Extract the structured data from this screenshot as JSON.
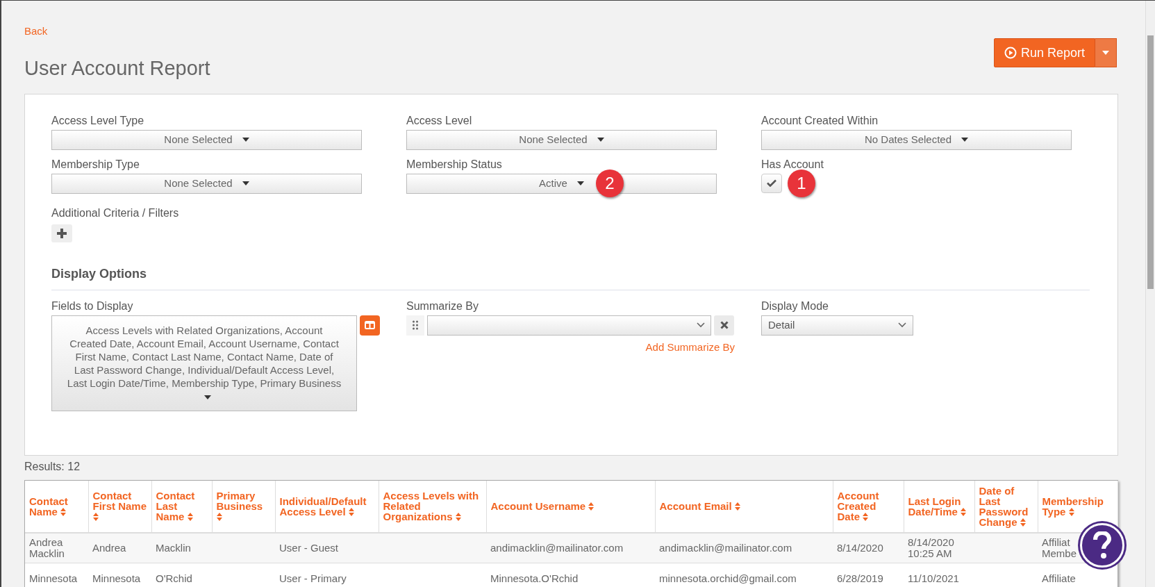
{
  "back_link": "Back",
  "title": "User Account Report",
  "run_button": {
    "label": "Run Report"
  },
  "filters": [
    {
      "label": "Access Level Type",
      "kind": "dropdown",
      "value": "None Selected"
    },
    {
      "label": "Access Level",
      "kind": "dropdown",
      "value": "None Selected"
    },
    {
      "label": "Account Created Within",
      "kind": "dropdown",
      "value": "No Dates Selected"
    },
    {
      "label": "Membership Type",
      "kind": "dropdown",
      "value": "None Selected"
    },
    {
      "label": "Membership Status",
      "kind": "dropdown",
      "value": "Active",
      "callout": "2"
    },
    {
      "label": "Has Account",
      "kind": "checkbox",
      "checked": true,
      "callout": "1"
    }
  ],
  "additional_criteria": {
    "label": "Additional Criteria / Filters"
  },
  "display_options": {
    "heading": "Display Options",
    "fields_to_display": {
      "label": "Fields to Display",
      "value": "Access Levels with Related Organizations,  Account Created Date,  Account Email,  Account Username,  Contact First Name,  Contact Last Name,  Contact Name,  Date of Last Password Change,  Individual/Default Access Level,  Last Login Date/Time,  Membership Type,  Primary Business"
    },
    "summarize_by": {
      "label": "Summarize By",
      "link": "Add Summarize By"
    },
    "display_mode": {
      "label": "Display Mode",
      "value": "Detail"
    }
  },
  "results": "Results: 12",
  "table": {
    "columns": [
      "Contact Name",
      "Contact First Name",
      "Contact Last Name",
      "Primary Business",
      "Individual/Default Access Level",
      "Access Levels with Related Organizations",
      "Account Username",
      "Account Email",
      "Account Created Date",
      "Last Login Date/Time",
      "Date of Last Password Change",
      "Membership Type"
    ],
    "rows": [
      [
        "Andrea Macklin",
        "Andrea",
        "Macklin",
        "",
        "User - Guest",
        "",
        "andimacklin@mailinator.com",
        "andimacklin@mailinator.com",
        "8/14/2020",
        "8/14/2020 10:25 AM",
        "",
        "Affiliat Membe"
      ],
      [
        "Minnesota",
        "Minnesota",
        "O'Rchid",
        "",
        "User - Primary",
        "",
        "Minnesota.O'Rchid",
        "minnesota.orchid@gmail.com",
        "6/28/2019",
        "11/10/2021",
        "",
        "Affiliate"
      ]
    ]
  }
}
